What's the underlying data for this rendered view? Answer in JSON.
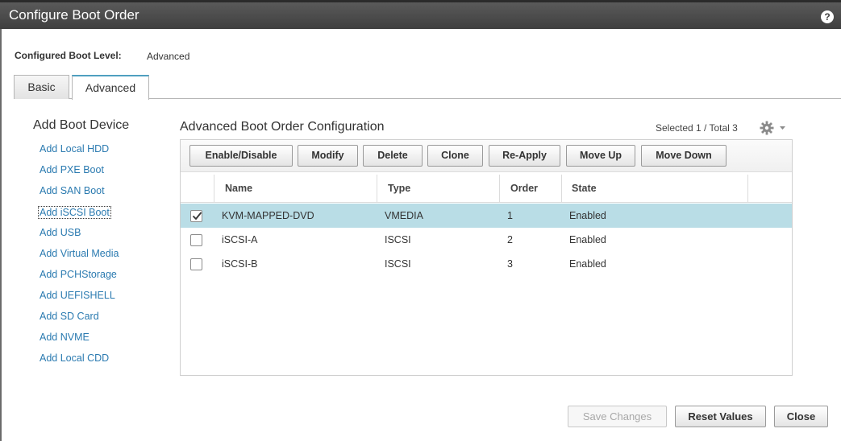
{
  "window": {
    "title": "Configure Boot Order",
    "help_icon": "?"
  },
  "boot_level": {
    "label": "Configured Boot Level:",
    "value": "Advanced"
  },
  "tabs": [
    {
      "label": "Basic",
      "active": false
    },
    {
      "label": "Advanced",
      "active": true
    }
  ],
  "add_boot_device": {
    "title": "Add Boot Device",
    "links": [
      "Add Local HDD",
      "Add PXE Boot",
      "Add SAN Boot",
      "Add iSCSI Boot",
      "Add USB",
      "Add Virtual Media",
      "Add PCHStorage",
      "Add UEFISHELL",
      "Add SD Card",
      "Add NVME",
      "Add Local CDD"
    ],
    "focused_link": "Add iSCSI Boot"
  },
  "config": {
    "title": "Advanced Boot Order Configuration",
    "selected_info": "Selected 1 / Total 3",
    "gear_icon": "gear-icon",
    "toolbar": [
      "Enable/Disable",
      "Modify",
      "Delete",
      "Clone",
      "Re-Apply",
      "Move Up",
      "Move Down"
    ],
    "columns": [
      "Name",
      "Type",
      "Order",
      "State"
    ],
    "rows": [
      {
        "checked": true,
        "name": "KVM-MAPPED-DVD",
        "type": "VMEDIA",
        "order": "1",
        "state": "Enabled"
      },
      {
        "checked": false,
        "name": "iSCSI-A",
        "type": "ISCSI",
        "order": "2",
        "state": "Enabled"
      },
      {
        "checked": false,
        "name": "iSCSI-B",
        "type": "ISCSI",
        "order": "3",
        "state": "Enabled"
      }
    ]
  },
  "footer": {
    "save": {
      "label": "Save Changes",
      "disabled": true
    },
    "reset": {
      "label": "Reset Values"
    },
    "close": {
      "label": "Close"
    }
  },
  "colors": {
    "title_bar": "#4a4a4a",
    "link": "#2a7ab0",
    "selected_row": "#b9dde6",
    "active_tab_accent": "#4f9fc0"
  }
}
